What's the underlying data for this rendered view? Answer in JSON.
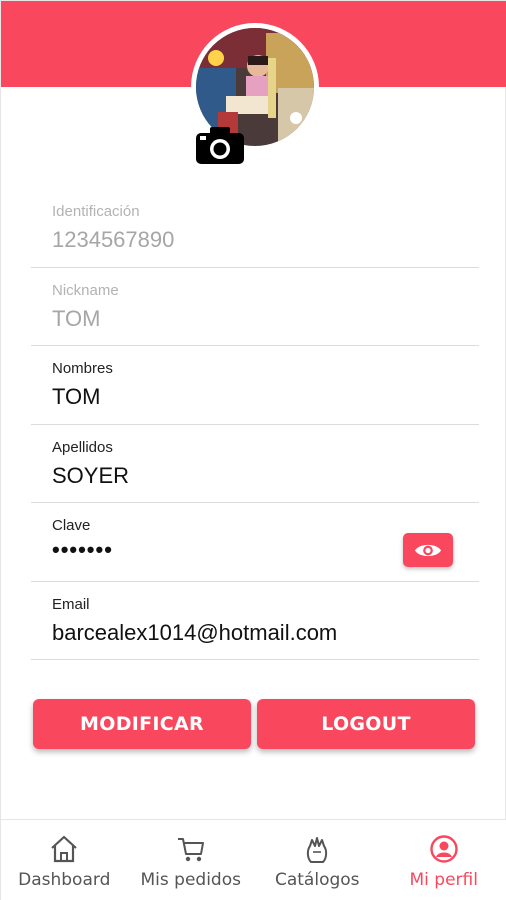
{
  "theme": {
    "accent": "#f9485d",
    "muted": "#a6a6a6"
  },
  "profile": {
    "avatar_icon": "profile-photo",
    "camera_icon": "camera-icon"
  },
  "fields": [
    {
      "label": "Identificación",
      "value": "1234567890",
      "disabled": true
    },
    {
      "label": "Nickname",
      "value": "TOM",
      "disabled": true
    },
    {
      "label": "Nombres",
      "value": "TOM",
      "disabled": false
    },
    {
      "label": "Apellidos",
      "value": "SOYER",
      "disabled": false
    },
    {
      "label": "Clave",
      "value": "•••••••",
      "disabled": false,
      "toggle_icon": "eye-icon"
    },
    {
      "label": "Email",
      "value": "barcealex1014@hotmail.com",
      "disabled": false
    }
  ],
  "actions": {
    "modify_label": "MODIFICAR",
    "logout_label": "LOGOUT"
  },
  "tabs": [
    {
      "label": "Dashboard",
      "icon": "home-icon",
      "active": false
    },
    {
      "label": "Mis pedidos",
      "icon": "cart-icon",
      "active": false
    },
    {
      "label": "Catálogos",
      "icon": "catalog-icon",
      "active": false
    },
    {
      "label": "Mi perfil",
      "icon": "user-circle-icon",
      "active": true
    }
  ]
}
